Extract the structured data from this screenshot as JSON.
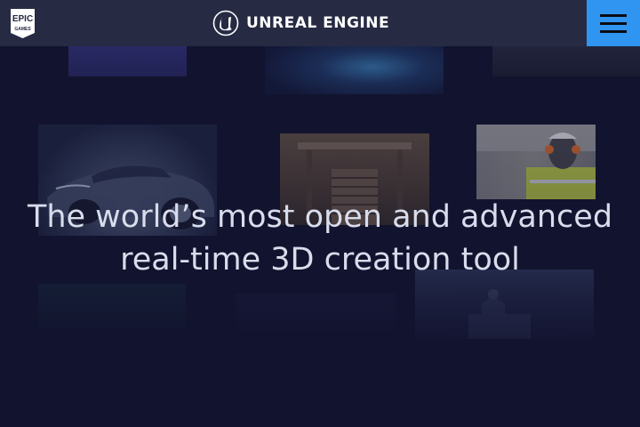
{
  "header": {
    "epic_logo_text_top": "EPIC",
    "epic_logo_text_bottom": "GAMES",
    "brand_name": "UNREAL ENGINE",
    "menu_icon": "hamburger-menu-icon",
    "colors": {
      "header_bg": "#262a43",
      "menu_accent": "#2f95f0",
      "page_bg": "#12132e"
    }
  },
  "hero": {
    "headline_line1": "The world’s most open and advanced",
    "headline_line2": "real-time 3D creation tool"
  },
  "gallery": {
    "tiles": [
      "abstract-art",
      "fantasy-battle",
      "car-detail",
      "sports-car",
      "grand-staircase",
      "construction-worker",
      "teal-scene",
      "dark-scene",
      "city-building"
    ]
  }
}
